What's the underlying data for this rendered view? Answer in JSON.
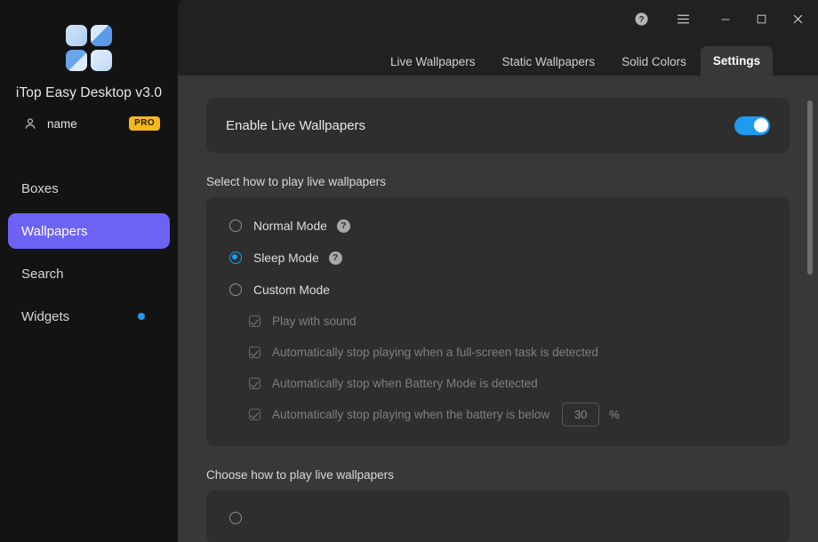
{
  "sidebar": {
    "logo_icon": "app-logo-four-squares",
    "app_title": "iTop Easy Desktop v3.0",
    "user": {
      "icon": "person-icon",
      "name": "name",
      "badge": "PRO"
    },
    "items": [
      {
        "label": "Boxes",
        "active": false,
        "dot": false
      },
      {
        "label": "Wallpapers",
        "active": true,
        "dot": false
      },
      {
        "label": "Search",
        "active": false,
        "dot": false
      },
      {
        "label": "Widgets",
        "active": false,
        "dot": true
      }
    ]
  },
  "titlebar": {
    "buttons": [
      {
        "name": "help-icon",
        "glyph": "?"
      },
      {
        "name": "menu-icon",
        "glyph": "☰"
      },
      {
        "name": "minimize-icon",
        "glyph": "─"
      },
      {
        "name": "maximize-icon",
        "glyph": "☐"
      },
      {
        "name": "close-icon",
        "glyph": "✕"
      }
    ]
  },
  "tabs": [
    {
      "label": "Live Wallpapers",
      "active": false
    },
    {
      "label": "Static Wallpapers",
      "active": false
    },
    {
      "label": "Solid Colors",
      "active": false
    },
    {
      "label": "Settings",
      "active": true
    }
  ],
  "settings": {
    "enable_card": {
      "label": "Enable Live Wallpapers",
      "toggle_on": true,
      "toggle_color": "#1e9bef"
    },
    "play_mode_section_label": "Select how to play live wallpapers",
    "modes": [
      {
        "label": "Normal Mode",
        "selected": false,
        "help": "?"
      },
      {
        "label": "Sleep Mode",
        "selected": true,
        "help": "?"
      },
      {
        "label": "Custom Mode",
        "selected": false,
        "help": ""
      }
    ],
    "custom_options": [
      {
        "label": "Play with sound",
        "checked": true,
        "disabled": true
      },
      {
        "label": "Automatically stop playing when a full-screen task is detected",
        "checked": true,
        "disabled": true
      },
      {
        "label": "Automatically stop when Battery Mode is detected",
        "checked": true,
        "disabled": true
      },
      {
        "label": "Automatically stop playing when the battery is below",
        "checked": true,
        "disabled": true
      }
    ],
    "battery_threshold": {
      "value": "30",
      "unit": "%"
    },
    "choose_section_label": "Choose how to play live wallpapers"
  },
  "colors": {
    "sidebar_bg": "#131313",
    "accent_nav": "#6c63f5",
    "content_bg": "#383838",
    "card_bg": "#2e2e2e",
    "topbar_bg": "#212121",
    "toggle_blue": "#1e9bef",
    "pro_badge": "#f5b71d",
    "widget_dot": "#1e9bef"
  },
  "scrollbar": {
    "name": "vertical-scrollbar"
  }
}
